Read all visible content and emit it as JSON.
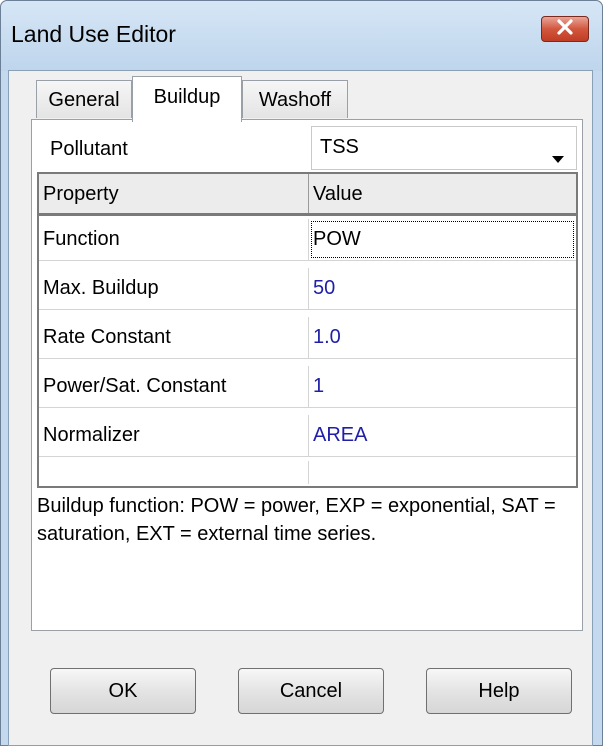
{
  "window": {
    "title": "Land Use Editor"
  },
  "tabs": [
    {
      "label": "General",
      "active": false
    },
    {
      "label": "Buildup",
      "active": true
    },
    {
      "label": "Washoff",
      "active": false
    }
  ],
  "pollutant": {
    "label": "Pollutant",
    "value": "TSS"
  },
  "grid": {
    "headers": {
      "property": "Property",
      "value": "Value"
    },
    "rows": [
      {
        "property": "Function",
        "value": "POW"
      },
      {
        "property": "Max. Buildup",
        "value": "50"
      },
      {
        "property": "Rate Constant",
        "value": "1.0"
      },
      {
        "property": "Power/Sat. Constant",
        "value": "1"
      },
      {
        "property": "Normalizer",
        "value": "AREA"
      }
    ]
  },
  "description": "Buildup function: POW = power, EXP = exponential, SAT = saturation, EXT = external time series.",
  "buttons": {
    "ok": "OK",
    "cancel": "Cancel",
    "help": "Help"
  },
  "colors": {
    "value_text": "#1f1fa8",
    "titlebar": "#c4d9ee",
    "close_button": "#c94a33"
  },
  "icons": {
    "close": "close-icon",
    "dropdown": "chevron-down-icon"
  }
}
